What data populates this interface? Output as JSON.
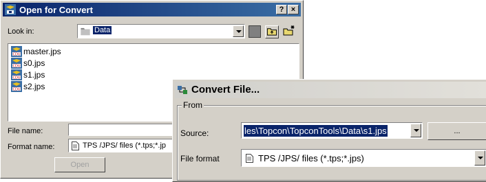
{
  "open_dialog": {
    "title": "Open for Convert",
    "help_button": "?",
    "close_button": "×",
    "look_in_label": "Look in:",
    "look_in_value": "Data",
    "files": [
      {
        "name": "master.jps",
        "icon": "jps-file-icon"
      },
      {
        "name": "s0.jps",
        "icon": "jps-file-icon"
      },
      {
        "name": "s1.jps",
        "icon": "jps-file-icon"
      },
      {
        "name": "s2.jps",
        "icon": "jps-file-icon"
      }
    ],
    "file_name_label": "File name:",
    "file_name_value": "",
    "format_name_label": "Format name:",
    "format_name_value": "TPS /JPS/ files (*.tps;*.jp",
    "open_button": "Open"
  },
  "convert_dialog": {
    "title": "Convert File...",
    "from_group": "From",
    "source_label": "Source:",
    "source_value": "les\\Topcon\\TopconTools\\Data\\s1.jps",
    "browse_button": "...",
    "file_format_label": "File format",
    "file_format_value": "TPS /JPS/ files (*.tps;*.jps)"
  },
  "colors": {
    "window_bg": "#d4d0c8",
    "title_active": "#0a246a",
    "selection": "#0a246a"
  }
}
